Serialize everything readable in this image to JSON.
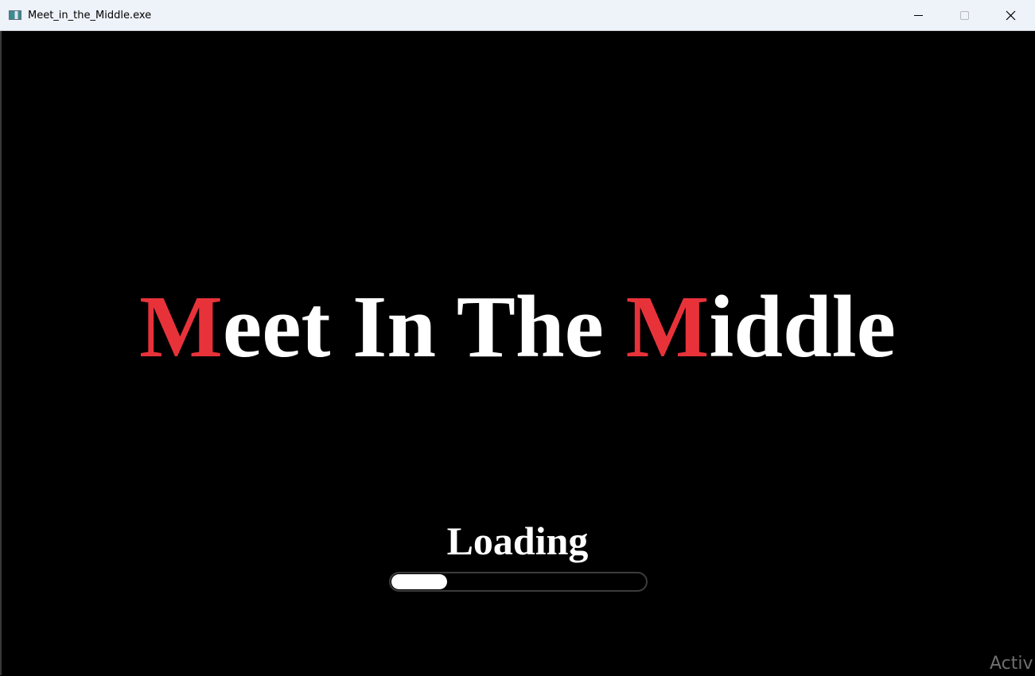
{
  "window": {
    "title": "Meet_in_the_Middle.exe",
    "icon": "app-window-icon",
    "controls": {
      "minimize_icon": "minimize-icon",
      "maximize_icon": "maximize-icon",
      "close_icon": "close-icon"
    }
  },
  "splash": {
    "title_parts": [
      {
        "text": "M",
        "accent": true
      },
      {
        "text": "eet In The ",
        "accent": false
      },
      {
        "text": "M",
        "accent": true
      },
      {
        "text": "iddle",
        "accent": false
      }
    ],
    "loading_label": "Loading",
    "progress": 0.22
  },
  "watermark": {
    "text": "Activ"
  },
  "colors": {
    "background": "#000000",
    "title_text": "#ffffff",
    "accent": "#e8323a",
    "titlebar": "#eef2f9",
    "progress_fill": "#ffffff",
    "progress_border": "#3c3c3c"
  }
}
